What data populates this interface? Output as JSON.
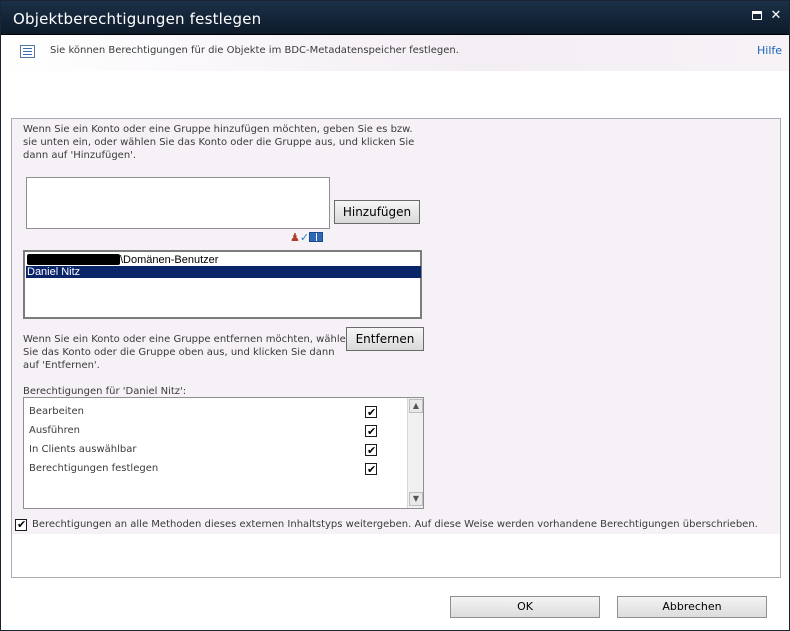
{
  "dialog": {
    "title": "Objektberechtigungen festlegen"
  },
  "infobar": {
    "text": "Sie können Berechtigungen für die Objekte im BDC-Metadatenspeicher festlegen.",
    "help_label": "Hilfe",
    "icon": "list-icon"
  },
  "add_section": {
    "instruction": "Wenn Sie ein Konto oder eine Gruppe hinzufügen möchten, geben Sie es bzw. sie unten ein, oder wählen Sie das Konto oder die Gruppe aus, und klicken Sie dann auf 'Hinzufügen'.",
    "input_value": "",
    "add_button": "Hinzufügen",
    "check_names_icon": "check-names-icon",
    "browse_icon": "address-book-icon"
  },
  "users": {
    "items": [
      {
        "label": "\\Domänen-Benutzer",
        "redacted_prefix": true,
        "selected": false
      },
      {
        "label": "Daniel Nitz",
        "redacted_prefix": false,
        "selected": true
      }
    ]
  },
  "remove_section": {
    "instruction": "Wenn Sie ein Konto oder eine Gruppe entfernen möchten, wählen Sie das Konto oder die Gruppe oben aus, und klicken Sie dann auf 'Entfernen'.",
    "remove_button": "Entfernen"
  },
  "permissions": {
    "label": "Berechtigungen für 'Daniel Nitz':",
    "items": [
      {
        "label": "Bearbeiten",
        "checked": true
      },
      {
        "label": "Ausführen",
        "checked": true
      },
      {
        "label": "In Clients auswählbar",
        "checked": true
      },
      {
        "label": "Berechtigungen festlegen",
        "checked": true
      }
    ]
  },
  "inherit": {
    "label": "Berechtigungen an alle Methoden dieses externen Inhaltstyps weitergeben. Auf diese Weise werden vorhandene Berechtigungen überschrieben.",
    "checked": true
  },
  "footer": {
    "ok_label": "OK",
    "cancel_label": "Abbrechen"
  }
}
